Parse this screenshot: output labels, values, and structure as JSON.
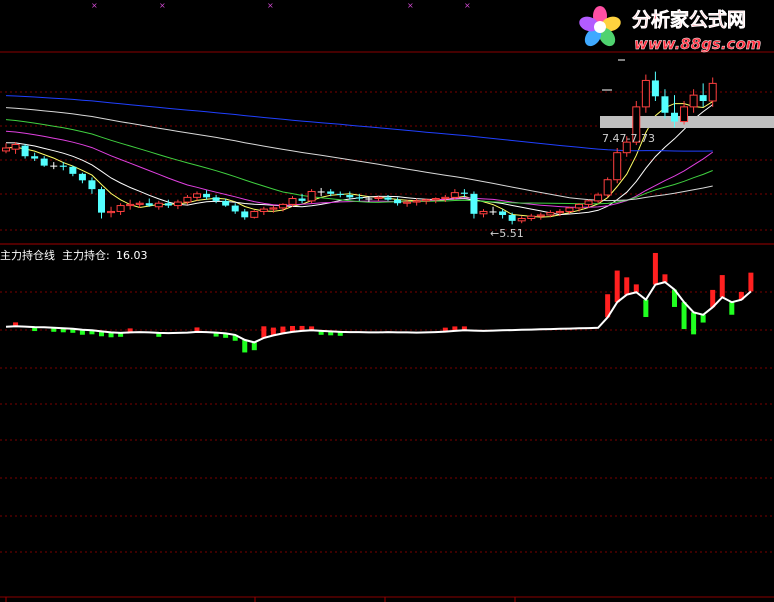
{
  "logo": {
    "title": "分析家公式网",
    "url": "www.88gs.com"
  },
  "chart_data": [
    {
      "type": "candlestick",
      "panel": "price",
      "annotations": [
        {
          "text": "7.47-7.73"
        },
        {
          "text": "←5.51"
        }
      ],
      "ohlc": [
        [
          7.55,
          7.68,
          7.51,
          7.6
        ],
        [
          7.58,
          7.7,
          7.5,
          7.66
        ],
        [
          7.64,
          7.67,
          7.42,
          7.46
        ],
        [
          7.46,
          7.52,
          7.38,
          7.42
        ],
        [
          7.42,
          7.46,
          7.28,
          7.3
        ],
        [
          7.3,
          7.36,
          7.24,
          7.3
        ],
        [
          7.3,
          7.36,
          7.22,
          7.28
        ],
        [
          7.28,
          7.3,
          7.12,
          7.16
        ],
        [
          7.16,
          7.18,
          7.0,
          7.05
        ],
        [
          7.05,
          7.1,
          6.82,
          6.9
        ],
        [
          6.9,
          6.94,
          6.4,
          6.5
        ],
        [
          6.5,
          6.6,
          6.42,
          6.52
        ],
        [
          6.52,
          6.66,
          6.46,
          6.62
        ],
        [
          6.62,
          6.72,
          6.55,
          6.64
        ],
        [
          6.64,
          6.7,
          6.58,
          6.66
        ],
        [
          6.66,
          6.74,
          6.6,
          6.62
        ],
        [
          6.6,
          6.7,
          6.55,
          6.66
        ],
        [
          6.66,
          6.72,
          6.58,
          6.62
        ],
        [
          6.62,
          6.72,
          6.56,
          6.68
        ],
        [
          6.68,
          6.8,
          6.64,
          6.76
        ],
        [
          6.76,
          6.86,
          6.7,
          6.82
        ],
        [
          6.82,
          6.88,
          6.72,
          6.76
        ],
        [
          6.76,
          6.8,
          6.66,
          6.7
        ],
        [
          6.7,
          6.74,
          6.6,
          6.62
        ],
        [
          6.62,
          6.66,
          6.48,
          6.52
        ],
        [
          6.52,
          6.56,
          6.38,
          6.42
        ],
        [
          6.42,
          6.54,
          6.4,
          6.52
        ],
        [
          6.52,
          6.6,
          6.46,
          6.56
        ],
        [
          6.56,
          6.62,
          6.5,
          6.58
        ],
        [
          6.58,
          6.66,
          6.52,
          6.64
        ],
        [
          6.64,
          6.78,
          6.6,
          6.74
        ],
        [
          6.74,
          6.82,
          6.66,
          6.7
        ],
        [
          6.7,
          6.9,
          6.66,
          6.86
        ],
        [
          6.86,
          6.92,
          6.78,
          6.86
        ],
        [
          6.86,
          6.9,
          6.78,
          6.82
        ],
        [
          6.82,
          6.86,
          6.76,
          6.8
        ],
        [
          6.8,
          6.86,
          6.72,
          6.76
        ],
        [
          6.76,
          6.82,
          6.7,
          6.74
        ],
        [
          6.74,
          6.78,
          6.68,
          6.74
        ],
        [
          6.74,
          6.78,
          6.7,
          6.76
        ],
        [
          6.76,
          6.8,
          6.7,
          6.72
        ],
        [
          6.72,
          6.76,
          6.62,
          6.66
        ],
        [
          6.66,
          6.72,
          6.6,
          6.68
        ],
        [
          6.68,
          6.74,
          6.62,
          6.7
        ],
        [
          6.7,
          6.74,
          6.64,
          6.72
        ],
        [
          6.72,
          6.76,
          6.66,
          6.74
        ],
        [
          6.74,
          6.8,
          6.68,
          6.76
        ],
        [
          6.76,
          6.9,
          6.72,
          6.84
        ],
        [
          6.84,
          6.9,
          6.76,
          6.82
        ],
        [
          6.82,
          6.86,
          6.4,
          6.48
        ],
        [
          6.48,
          6.56,
          6.42,
          6.52
        ],
        [
          6.52,
          6.6,
          6.46,
          6.52
        ],
        [
          6.52,
          6.56,
          6.4,
          6.46
        ],
        [
          6.46,
          6.5,
          6.3,
          6.36
        ],
        [
          6.36,
          6.44,
          6.32,
          6.4
        ],
        [
          6.4,
          6.48,
          6.36,
          6.44
        ],
        [
          6.44,
          6.5,
          6.38,
          6.46
        ],
        [
          6.46,
          6.54,
          6.42,
          6.5
        ],
        [
          6.5,
          6.56,
          6.44,
          6.52
        ],
        [
          6.52,
          6.6,
          6.48,
          6.58
        ],
        [
          6.58,
          6.66,
          6.52,
          6.64
        ],
        [
          6.64,
          6.72,
          6.58,
          6.7
        ],
        [
          6.7,
          6.84,
          6.66,
          6.8
        ],
        [
          6.8,
          7.1,
          6.76,
          7.06
        ],
        [
          7.06,
          7.6,
          7.0,
          7.52
        ],
        [
          7.52,
          7.8,
          7.45,
          7.7
        ],
        [
          7.7,
          8.4,
          7.65,
          8.3
        ],
        [
          8.3,
          8.85,
          8.2,
          8.75
        ],
        [
          8.75,
          8.9,
          8.4,
          8.48
        ],
        [
          8.48,
          8.6,
          8.1,
          8.2
        ],
        [
          8.2,
          8.5,
          7.95,
          8.05
        ],
        [
          8.05,
          8.4,
          8.0,
          8.3
        ],
        [
          8.3,
          8.6,
          8.2,
          8.5
        ],
        [
          8.5,
          8.7,
          8.3,
          8.4
        ],
        [
          8.4,
          8.8,
          8.3,
          8.7
        ]
      ]
    },
    {
      "type": "line",
      "panel": "indicator",
      "title": "主力持仓线",
      "value_label": "主力持仓:",
      "value": "16.03",
      "series": [
        {
          "values": [
            14.62,
            14.64,
            14.63,
            14.61,
            14.6,
            14.58,
            14.56,
            14.54,
            14.5,
            14.48,
            14.44,
            14.4,
            14.38,
            14.4,
            14.41,
            14.4,
            14.38,
            14.37,
            14.38,
            14.39,
            14.42,
            14.41,
            14.39,
            14.36,
            14.3,
            14.1,
            14.0,
            14.18,
            14.28,
            14.36,
            14.42,
            14.46,
            14.48,
            14.46,
            14.44,
            14.42,
            14.41,
            14.41,
            14.4,
            14.4,
            14.41,
            14.4,
            14.4,
            14.39,
            14.4,
            14.41,
            14.43,
            14.46,
            14.48,
            14.47,
            14.46,
            14.47,
            14.48,
            14.49,
            14.5,
            14.51,
            14.52,
            14.53,
            14.54,
            14.55,
            14.56,
            14.57,
            14.58,
            15.0,
            15.6,
            15.9,
            16.0,
            15.7,
            16.3,
            16.4,
            16.1,
            15.6,
            15.2,
            15.1,
            15.4,
            15.8,
            15.6,
            15.7,
            16.03
          ]
        }
      ]
    }
  ]
}
